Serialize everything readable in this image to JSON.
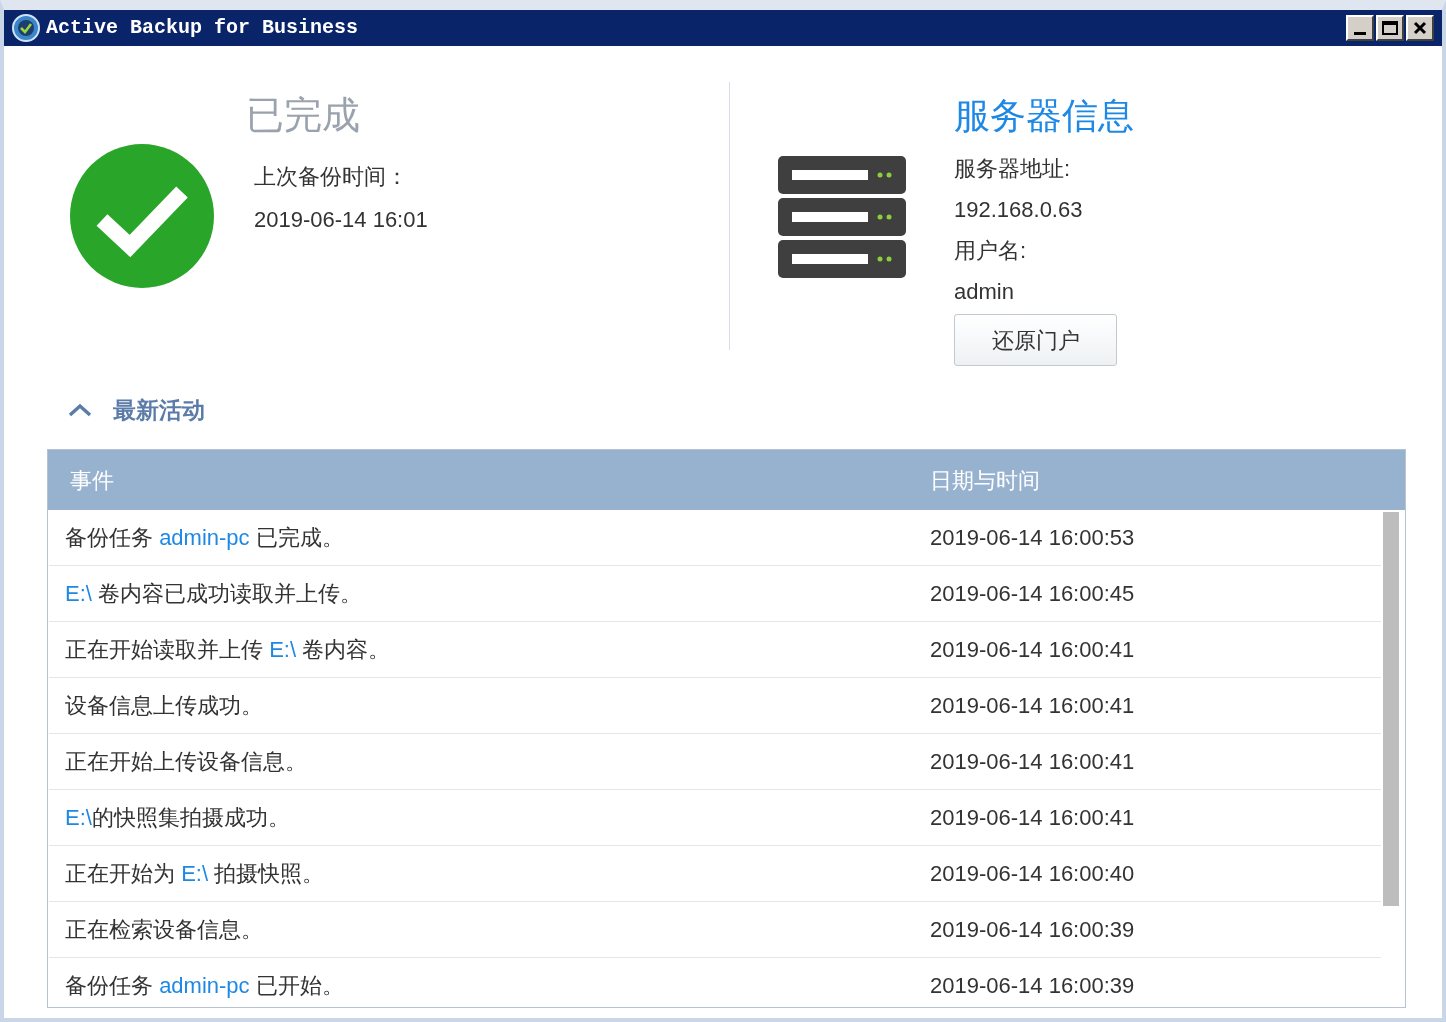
{
  "window": {
    "title": "Active Backup for Business"
  },
  "status": {
    "kind": "done",
    "title": "已完成",
    "last_backup_label": "上次备份时间：",
    "last_backup_time": "2019-06-14 16:01"
  },
  "server": {
    "title": "服务器信息",
    "address_label": "服务器地址:",
    "address": "192.168.0.63",
    "user_label": "用户名:",
    "user": "admin",
    "button": "还原门户"
  },
  "activity": {
    "title": "最新活动",
    "expanded": true,
    "columns": [
      "事件",
      "日期与时间"
    ],
    "rows": [
      {
        "event": [
          {
            "kind": "text",
            "text": "备份任务 "
          },
          {
            "kind": "link",
            "text": "admin-pc"
          },
          {
            "kind": "text",
            "text": " 已完成。"
          }
        ],
        "time": "2019-06-14 16:00:53"
      },
      {
        "event": [
          {
            "kind": "link",
            "text": "E:\\"
          },
          {
            "kind": "text",
            "text": " 卷内容已成功读取并上传。"
          }
        ],
        "time": "2019-06-14 16:00:45"
      },
      {
        "event": [
          {
            "kind": "text",
            "text": "正在开始读取并上传 "
          },
          {
            "kind": "link",
            "text": "E:\\"
          },
          {
            "kind": "text",
            "text": " 卷内容。"
          }
        ],
        "time": "2019-06-14 16:00:41"
      },
      {
        "event": [
          {
            "kind": "text",
            "text": "设备信息上传成功。"
          }
        ],
        "time": "2019-06-14 16:00:41"
      },
      {
        "event": [
          {
            "kind": "text",
            "text": "正在开始上传设备信息。"
          }
        ],
        "time": "2019-06-14 16:00:41"
      },
      {
        "event": [
          {
            "kind": "link",
            "text": "E:\\"
          },
          {
            "kind": "text",
            "text": "的快照集拍摄成功。"
          }
        ],
        "time": "2019-06-14 16:00:41"
      },
      {
        "event": [
          {
            "kind": "text",
            "text": "正在开始为 "
          },
          {
            "kind": "link",
            "text": "E:\\"
          },
          {
            "kind": "text",
            "text": " 拍摄快照。"
          }
        ],
        "time": "2019-06-14 16:00:40"
      },
      {
        "event": [
          {
            "kind": "text",
            "text": "正在检索设备信息。"
          }
        ],
        "time": "2019-06-14 16:00:39"
      },
      {
        "event": [
          {
            "kind": "text",
            "text": "备份任务 "
          },
          {
            "kind": "link",
            "text": "admin-pc"
          },
          {
            "kind": "text",
            "text": " 已开始。"
          }
        ],
        "time": "2019-06-14 16:00:39"
      }
    ]
  }
}
